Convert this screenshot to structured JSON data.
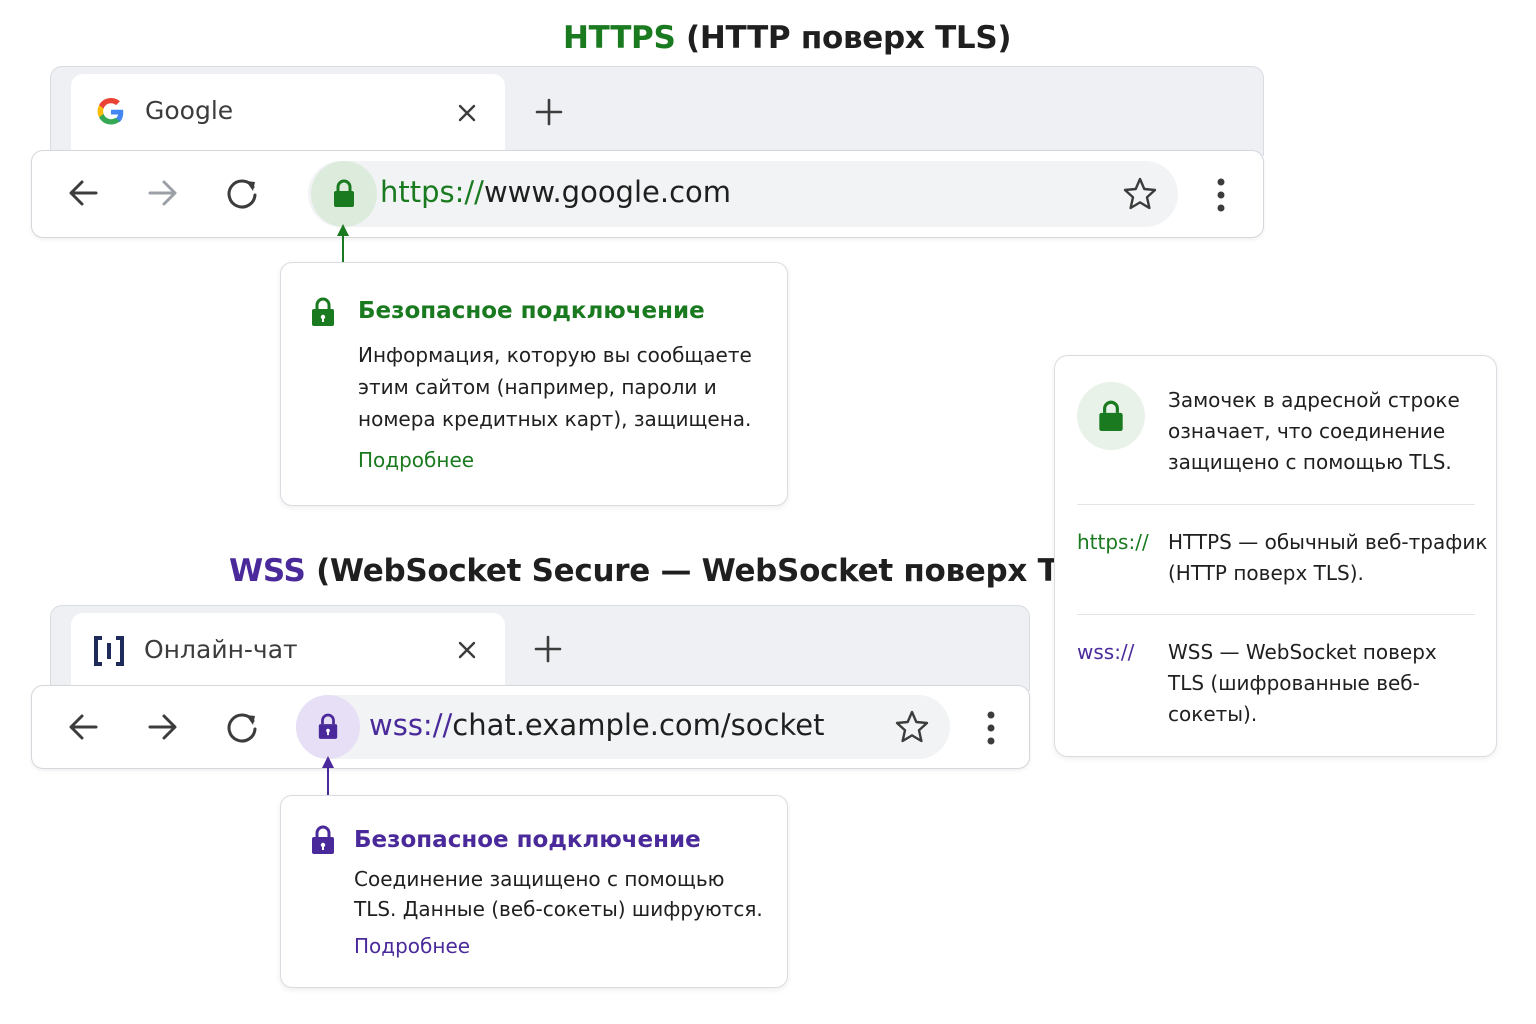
{
  "https_section": {
    "title_accent": "HTTPS",
    "title_rest": "(HTTP поверх TLS)",
    "tab": {
      "title": "Google",
      "icon": "google-g-icon"
    },
    "url_scheme": "https://",
    "url_rest": "www.google.com",
    "popup": {
      "heading": "Безопасное подключение",
      "body": "Информация, которую вы сообщаете этим сайтом (например, пароли и номера кредитных карт), защищена.",
      "link": "Подробнее"
    },
    "accent_color": "#1a7a1f"
  },
  "wss_section": {
    "title_accent": "WSS",
    "title_rest": "(WebSocket Secure — WebSocket поверх TLS)",
    "tab": {
      "title": "Онлайн-чат",
      "icon": "chat-brackets-icon"
    },
    "url_scheme": "wss://",
    "url_rest": "chat.example.com/socket",
    "popup": {
      "heading": "Безопасное подключение",
      "body": "Соединение защищено с помощью TLS. Данные (веб-сокеты) шифруются.",
      "link": "Подробнее"
    },
    "accent_color": "#4a2a9a"
  },
  "legend": {
    "lock_text": "Замочек в адресной строке означает, что соединение защищено с помощью TLS.",
    "items": [
      {
        "scheme": "https://",
        "text": "HTTPS — обычный веб-трафик (HTTP поверх TLS)."
      },
      {
        "scheme": "wss://",
        "text": "WSS — WebSocket поверх TLS (шифрованные веб-сокеты)."
      }
    ]
  }
}
